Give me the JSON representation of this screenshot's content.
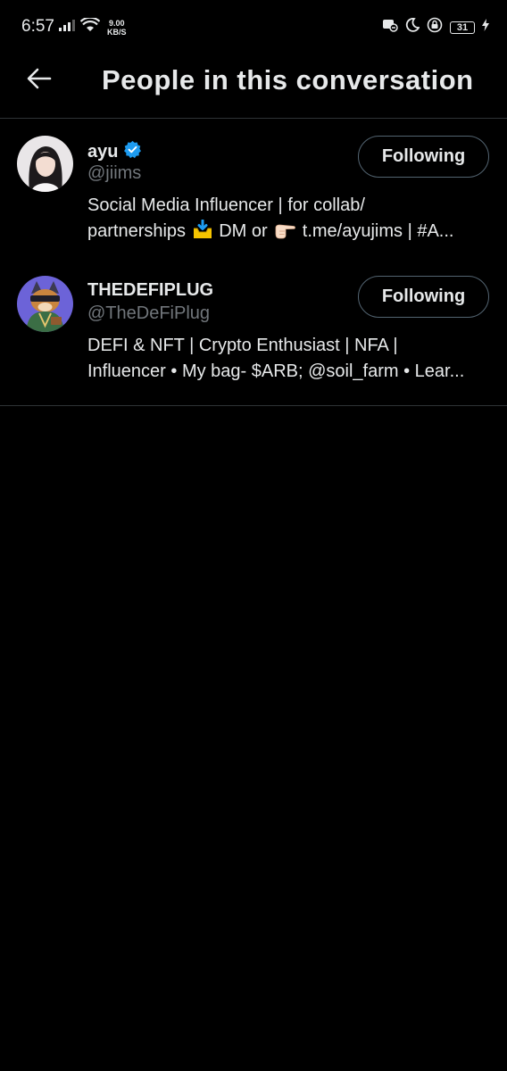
{
  "status_bar": {
    "time": "6:57",
    "net_speed_value": "9.00",
    "net_speed_unit": "KB/S",
    "battery_level": "31"
  },
  "header": {
    "title": "People in this conversation",
    "back_icon": "arrow-left-icon"
  },
  "colors": {
    "background": "#000000",
    "primary_text": "#e7e9ea",
    "secondary_text": "#71767b",
    "divider": "#2f3336",
    "verified_badge": "#1d9bf0"
  },
  "users": [
    {
      "name": "ayu",
      "verified": true,
      "handle": "@jiims",
      "follow_label": "Following",
      "bio_line1": "Social Media Influencer | for collab/",
      "bio_line2_a": "partnerships",
      "bio_line2_emoji1": "inbox-tray-emoji",
      "bio_line2_b": "DM or",
      "bio_line2_emoji2": "backhand-index-pointing-right-emoji",
      "bio_line2_c": "t.me/ayujims | #A..."
    },
    {
      "name": "THEDEFIPLUG",
      "verified": false,
      "handle": "@TheDeFiPlug",
      "follow_label": "Following",
      "bio_line1": "DEFI & NFT | Crypto Enthusiast | NFA |",
      "bio_line2": "Influencer • My bag- $ARB; @soil_farm • Lear..."
    }
  ]
}
